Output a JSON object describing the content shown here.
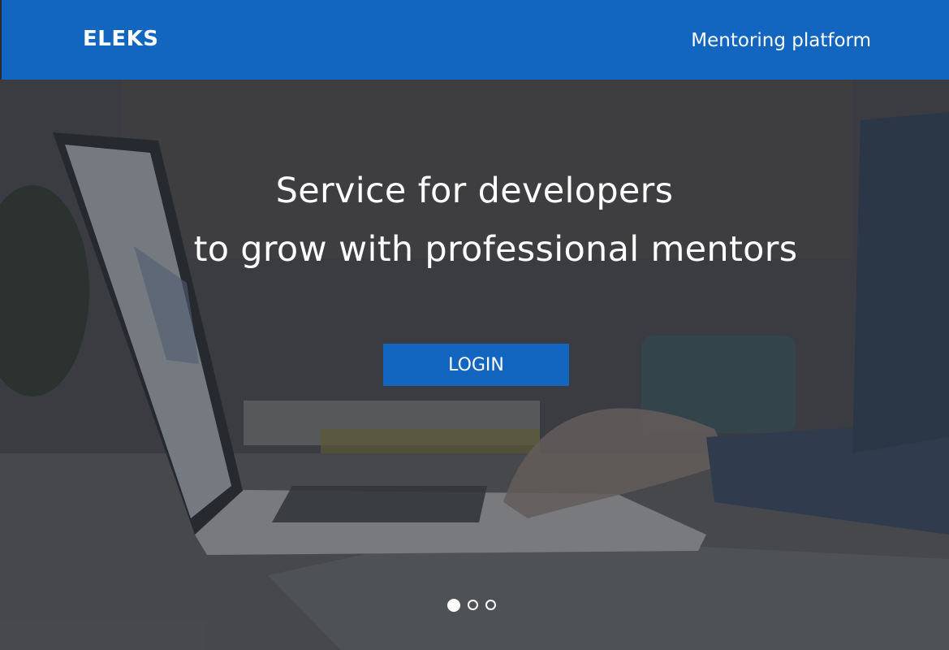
{
  "header": {
    "brand": "ELEKS",
    "subtitle": "Mentoring platform"
  },
  "hero": {
    "headline_line1": "Service for developers",
    "headline_line2": "to grow with professional mentors",
    "login_label": "LOGIN",
    "carousel": {
      "slides": 3,
      "active_index": 0
    }
  },
  "colors": {
    "brand_blue": "#1266bf",
    "text": "#ffffff",
    "hero_dark": "#3d3f44"
  },
  "background_image": {
    "description_icon": "laptop-photo"
  }
}
